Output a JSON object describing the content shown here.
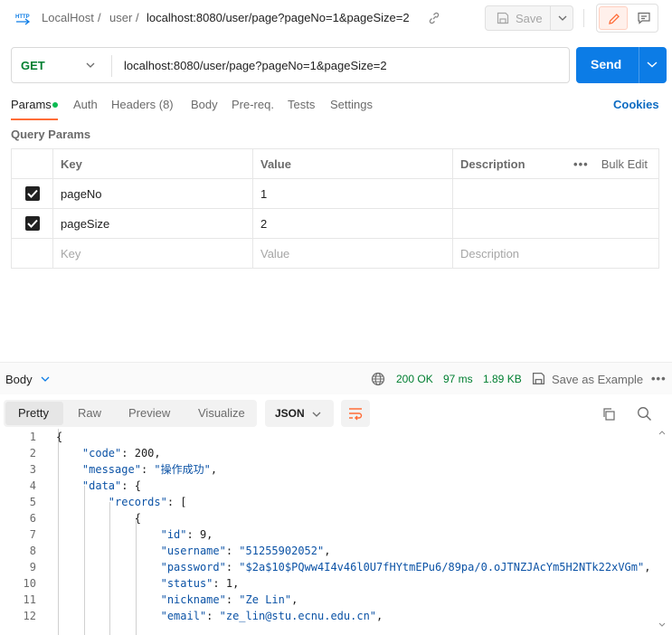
{
  "topbar": {
    "crumb_root": "LocalHost",
    "sep1": "/",
    "crumb_folder": "user",
    "sep2": "/",
    "crumb_request": "localhost:8080/user/page?pageNo=1&pageSize=2",
    "save_label": "Save"
  },
  "request": {
    "method": "GET",
    "url": "localhost:8080/user/page?pageNo=1&pageSize=2",
    "send_label": "Send"
  },
  "tabs": {
    "params": "Params",
    "auth": "Auth",
    "headers": "Headers (8)",
    "body": "Body",
    "prereq": "Pre-req.",
    "tests": "Tests",
    "settings": "Settings",
    "cookies": "Cookies"
  },
  "query_params": {
    "title": "Query Params",
    "headers": {
      "key": "Key",
      "value": "Value",
      "description": "Description",
      "bulk_edit": "Bulk Edit"
    },
    "rows": [
      {
        "key": "pageNo",
        "value": "1",
        "description": "",
        "checked": true
      },
      {
        "key": "pageSize",
        "value": "2",
        "description": "",
        "checked": true
      }
    ],
    "placeholder": {
      "key": "Key",
      "value": "Value",
      "description": "Description"
    }
  },
  "response": {
    "body_label": "Body",
    "status": "200 OK",
    "time": "97 ms",
    "size": "1.89 KB",
    "save_example": "Save as Example",
    "views": {
      "pretty": "Pretty",
      "raw": "Raw",
      "preview": "Preview",
      "visualize": "Visualize"
    },
    "format": "JSON",
    "lines": [
      {
        "n": "1",
        "t": "{"
      },
      {
        "n": "2",
        "t": "    \"code\": 200,"
      },
      {
        "n": "3",
        "t": "    \"message\": \"操作成功\","
      },
      {
        "n": "4",
        "t": "    \"data\": {"
      },
      {
        "n": "5",
        "t": "        \"records\": ["
      },
      {
        "n": "6",
        "t": "            {"
      },
      {
        "n": "7",
        "t": "                \"id\": 9,"
      },
      {
        "n": "8",
        "t": "                \"username\": \"51255902052\","
      },
      {
        "n": "9",
        "t": "                \"password\": \"$2a$10$PQww4I4v46l0U7fHYtmEPu6/89pa/0.oJTNZJAcYm5H2NTk22xVGm\","
      },
      {
        "n": "10",
        "t": "                \"status\": 1,"
      },
      {
        "n": "11",
        "t": "                \"nickname\": \"Ze Lin\","
      },
      {
        "n": "12",
        "t": "                \"email\": \"ze_lin@stu.ecnu.edu.cn\","
      }
    ]
  },
  "colors": {
    "accent": "#ff6c37",
    "send": "#0c7ce6",
    "get": "#007f31",
    "status_ok": "#007f31",
    "json_string": "#0c53a6"
  }
}
